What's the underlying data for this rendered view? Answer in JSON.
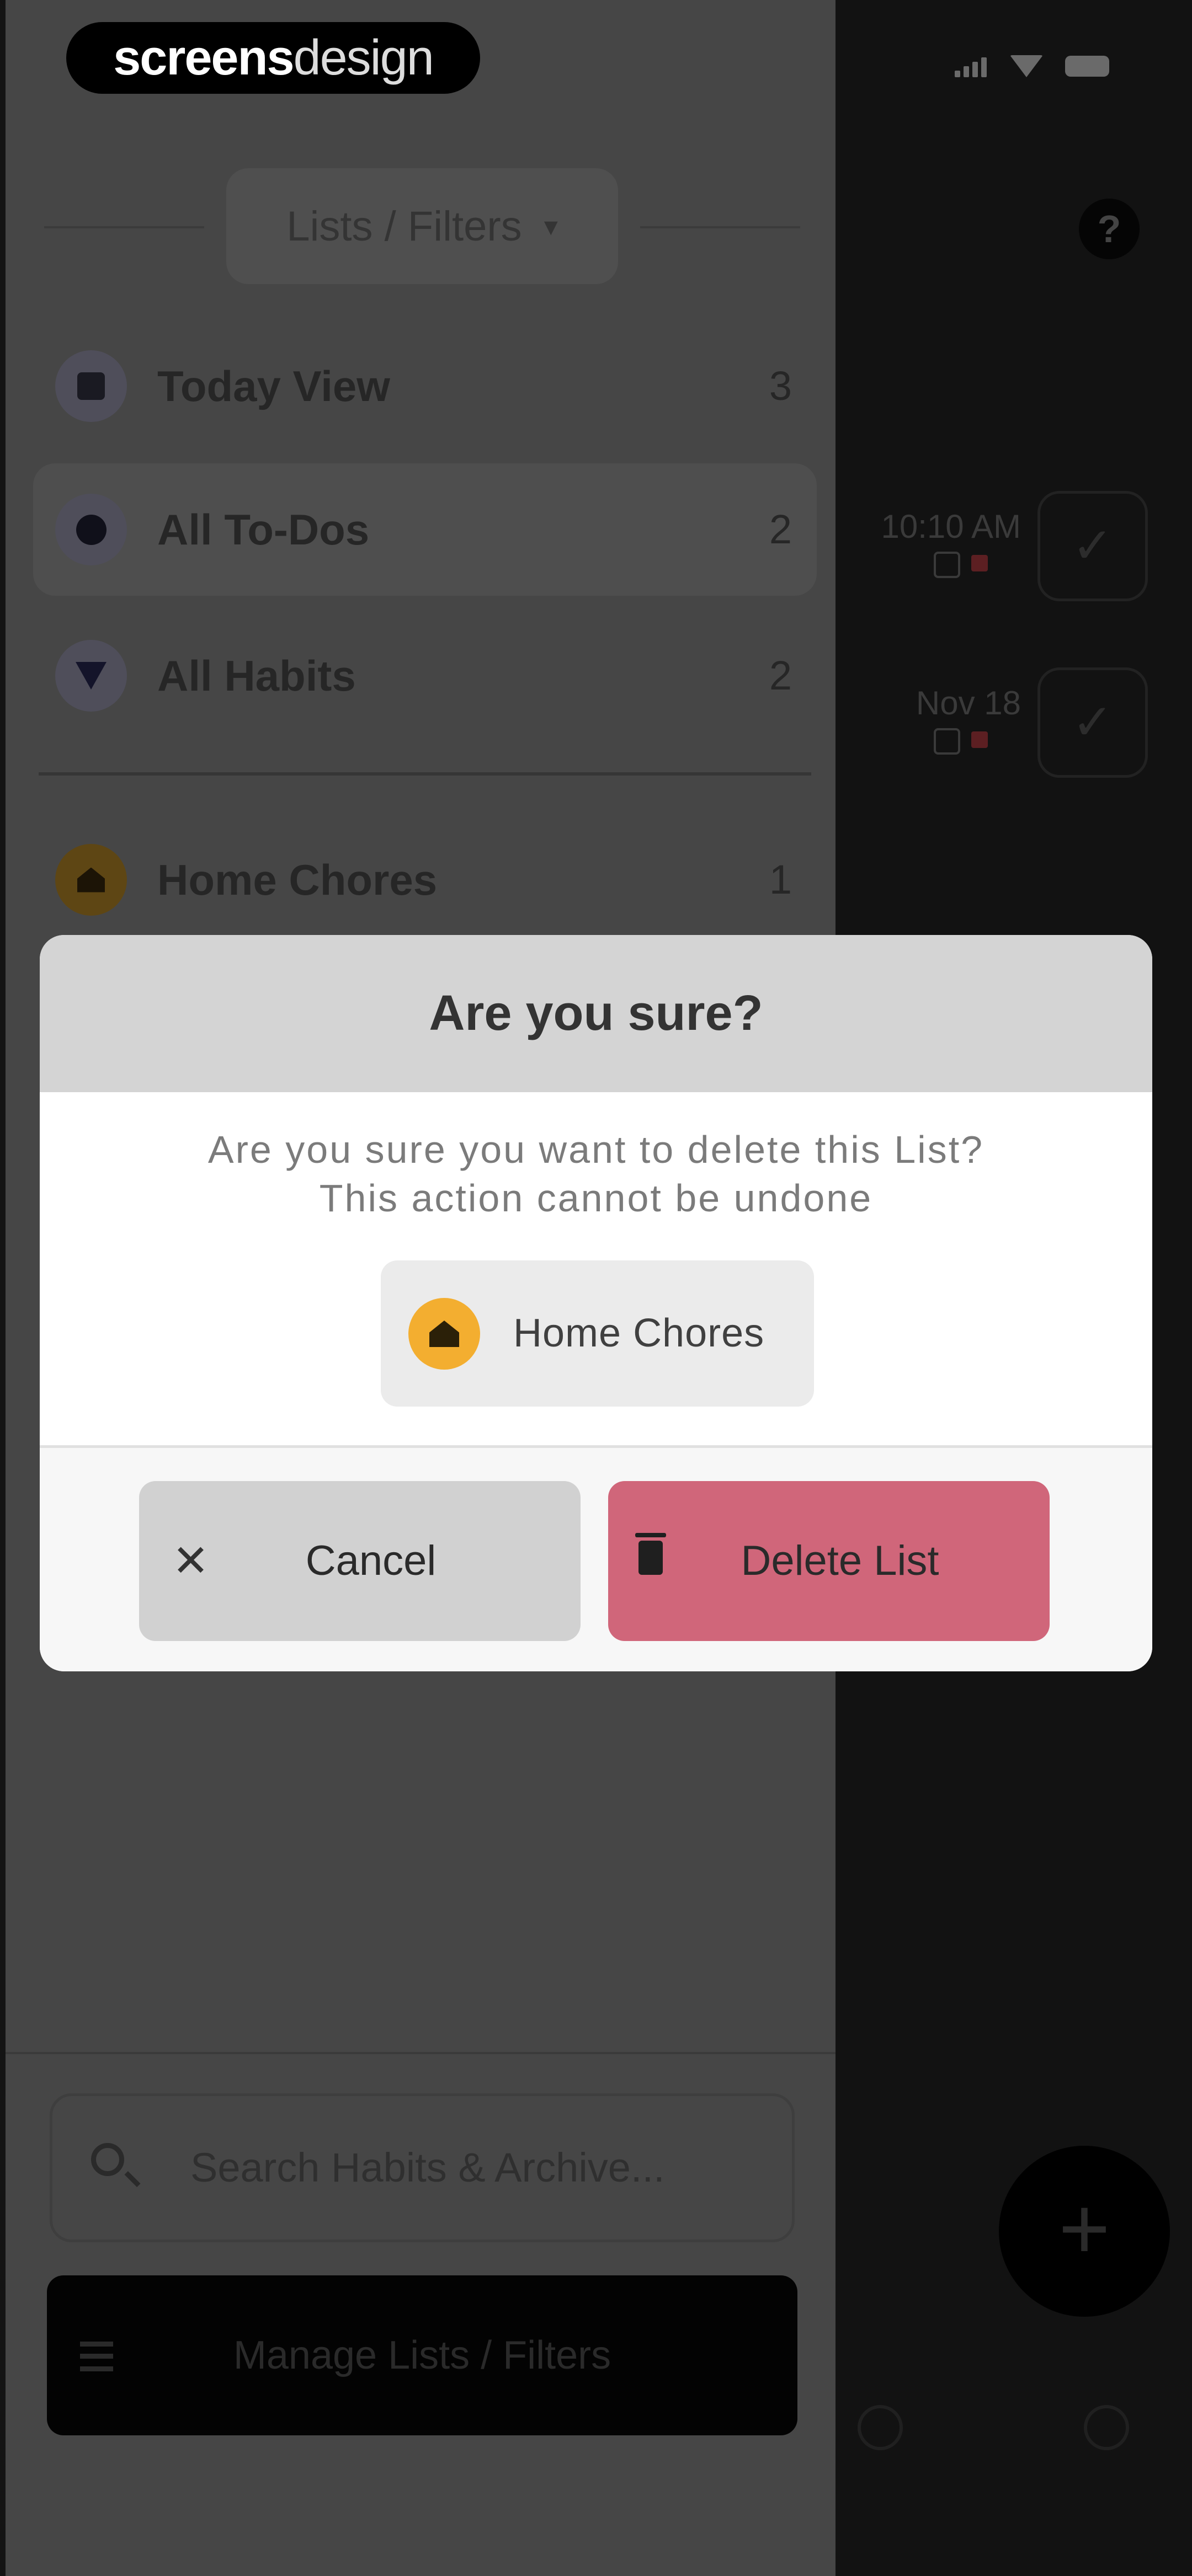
{
  "watermark": {
    "bold": "screens",
    "light": "design"
  },
  "drawer": {
    "filter_label": "Lists / Filters",
    "nav": [
      {
        "label": "Today View",
        "count": "3",
        "icon": "calendar-icon"
      },
      {
        "label": "All To-Dos",
        "count": "2",
        "icon": "todo-dot-icon"
      },
      {
        "label": "All Habits",
        "count": "2",
        "icon": "habit-icon"
      }
    ],
    "lists": [
      {
        "label": "Home Chores",
        "count": "1",
        "icon": "house-icon",
        "color": "#f3ae30"
      }
    ],
    "search_placeholder": "Search Habits & Archive...",
    "manage_label": "Manage Lists / Filters"
  },
  "background": {
    "task_dates": [
      "10:10 AM",
      "Nov 18"
    ],
    "fab_label": "+"
  },
  "dialog": {
    "title": "Are you sure?",
    "message_line1": "Are you sure you want to delete this List?",
    "message_line2": "This action cannot be undone",
    "list_name": "Home Chores",
    "cancel_label": "Cancel",
    "delete_label": "Delete List",
    "colors": {
      "accent": "#f3ae30",
      "danger": "#d0667a"
    }
  }
}
